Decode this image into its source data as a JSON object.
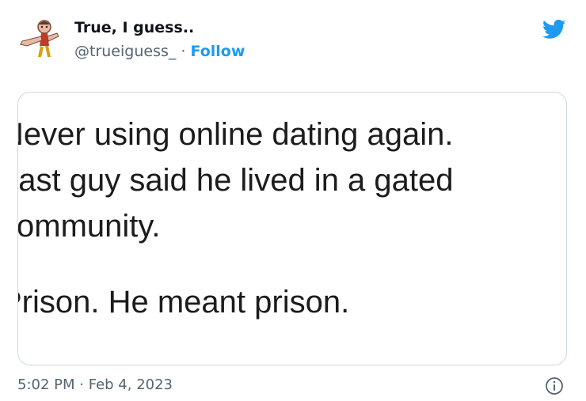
{
  "author": {
    "display_name": "True, I guess..",
    "handle": "@trueiguess_",
    "separator": " · ",
    "follow_label": "Follow",
    "avatar_icon": "cartoon-character-avatar"
  },
  "brand": {
    "icon": "twitter-bird-icon",
    "color": "#1d9bf0"
  },
  "media": {
    "lines": [
      "Never using online dating again.",
      "Last guy said he lived in a gated",
      "community.",
      "Prison. He meant prison."
    ]
  },
  "meta": {
    "time": "5:02 PM",
    "separator": " · ",
    "date": "Feb 4, 2023",
    "info_icon": "info-circle-icon"
  }
}
